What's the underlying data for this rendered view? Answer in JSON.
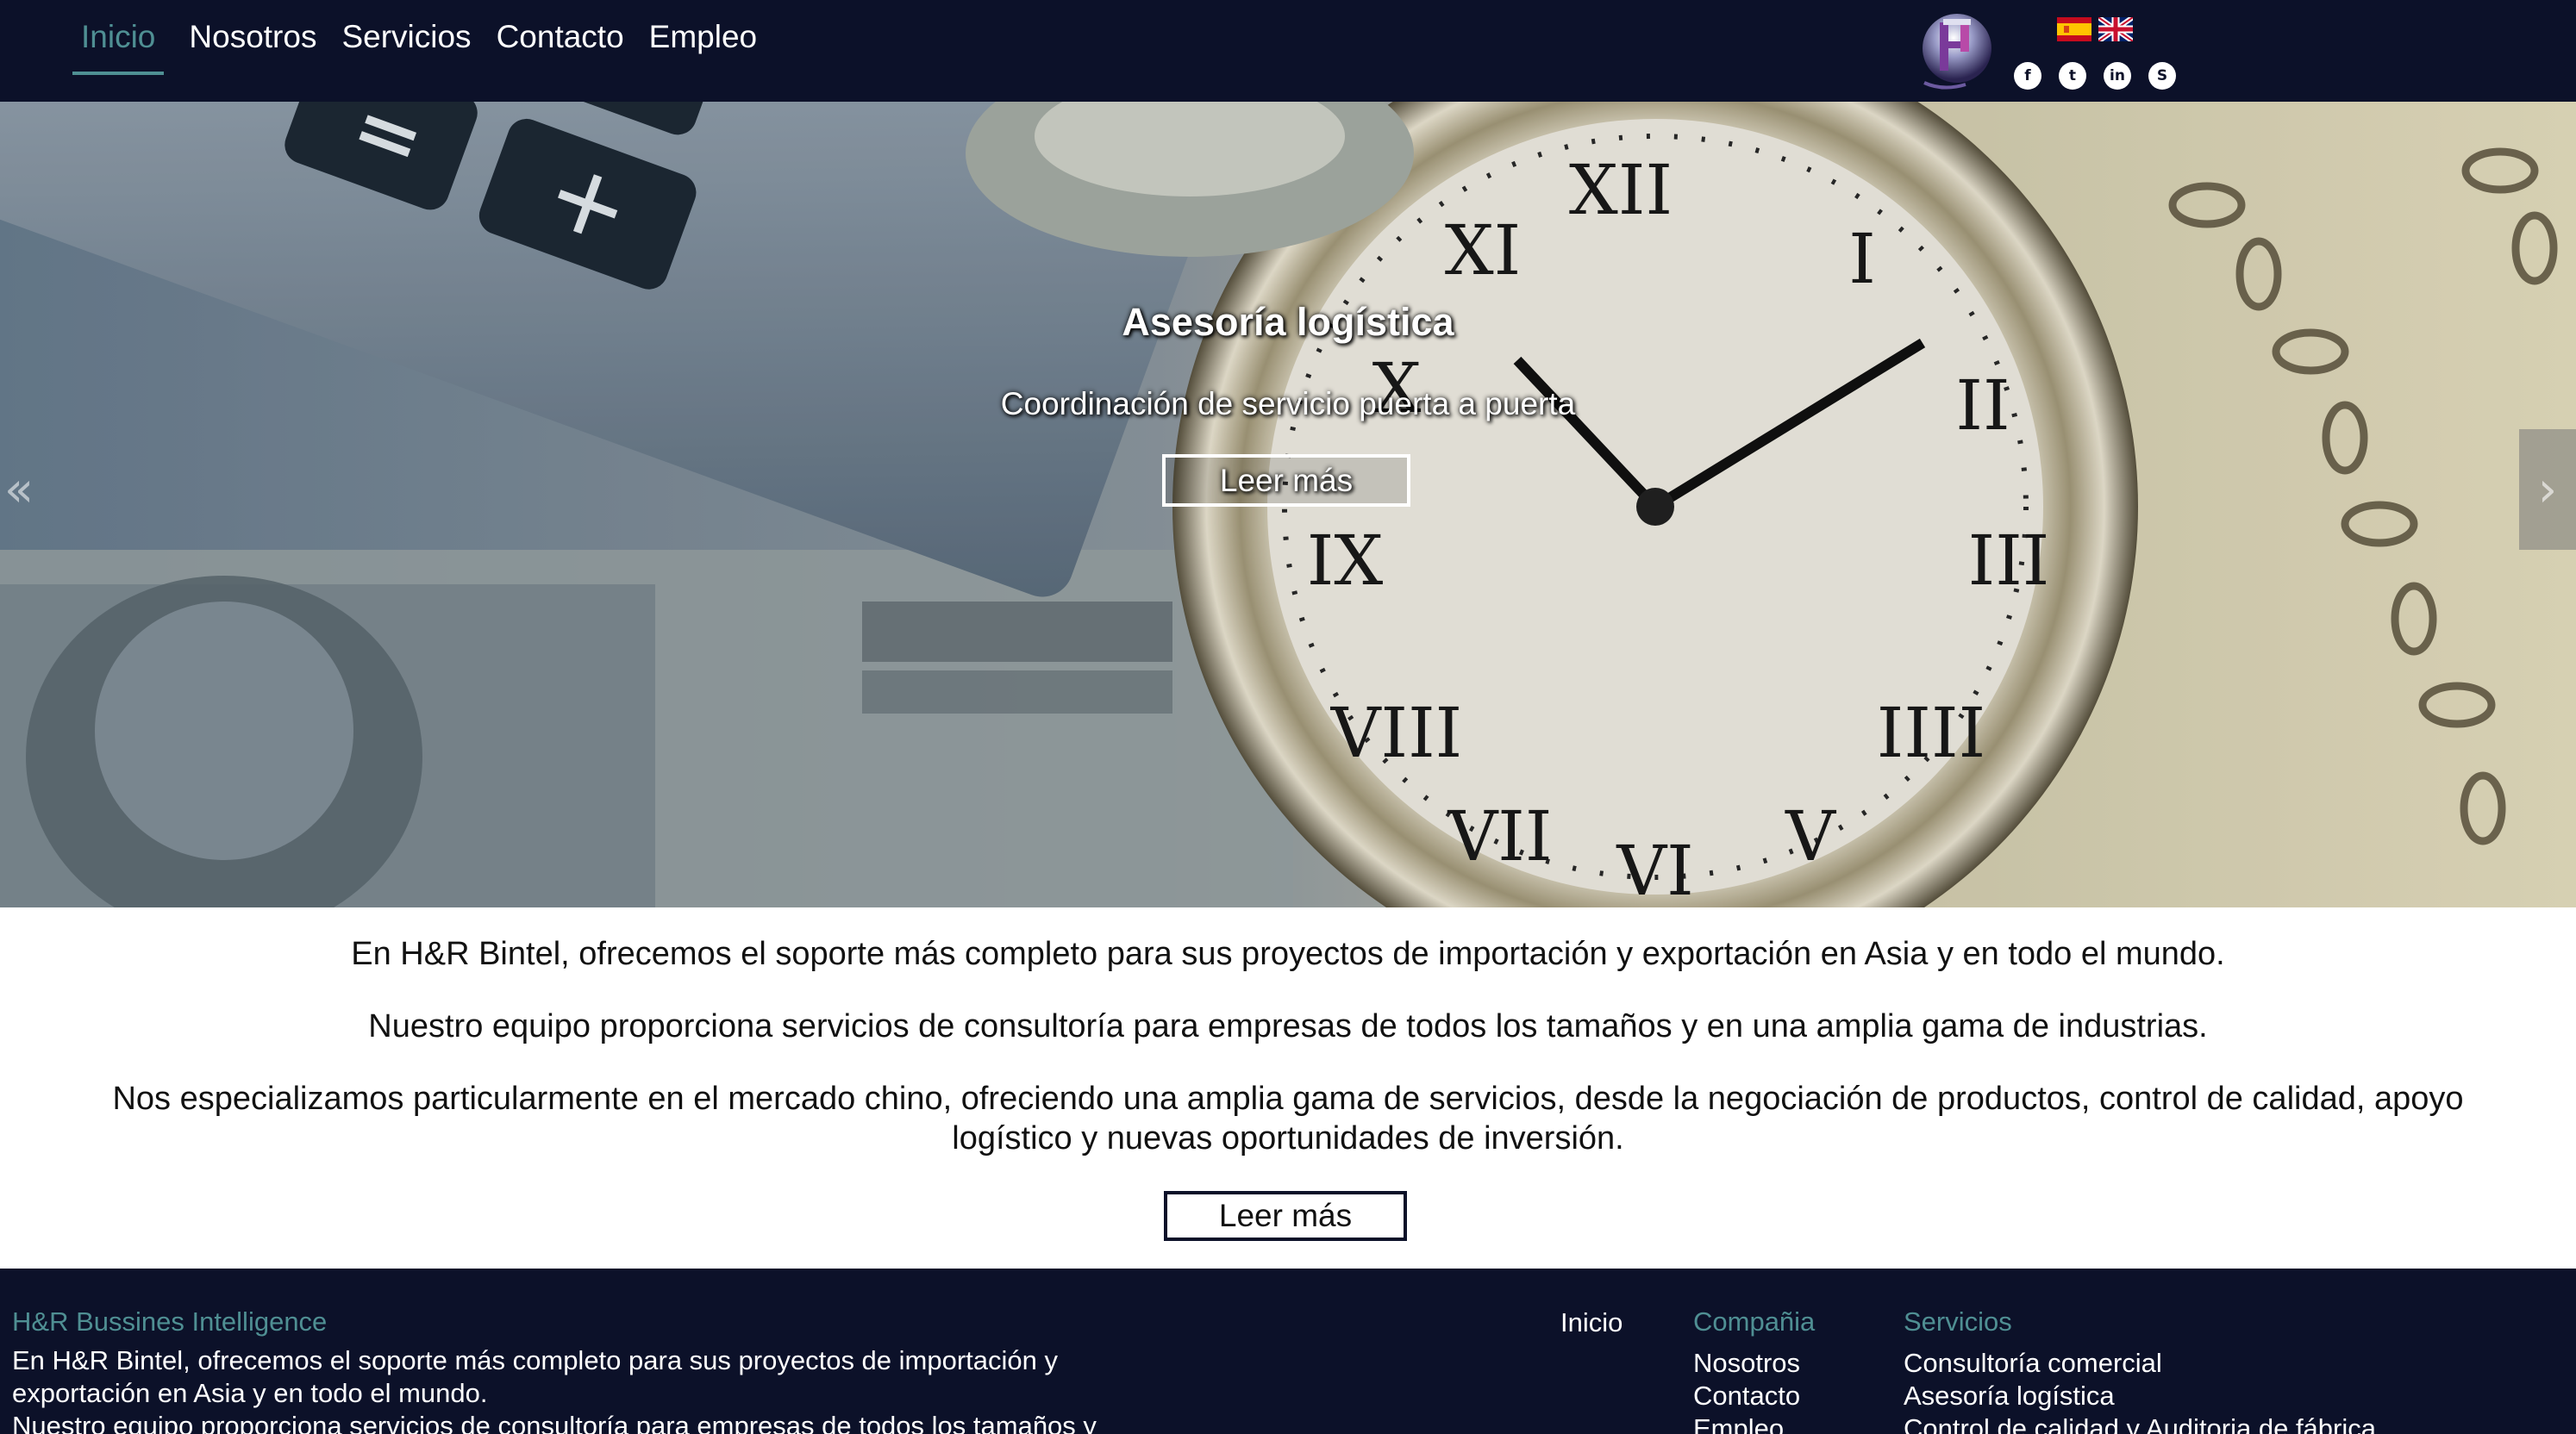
{
  "nav": {
    "items": [
      {
        "label": "Inicio",
        "active": true
      },
      {
        "label": "Nosotros"
      },
      {
        "label": "Servicios"
      },
      {
        "label": "Contacto"
      },
      {
        "label": "Empleo"
      }
    ]
  },
  "header": {
    "logo": "hr-bintel-logo-icon",
    "languages": [
      {
        "name": "spanish-flag-icon"
      },
      {
        "name": "uk-flag-icon"
      }
    ],
    "social": [
      {
        "name": "facebook-icon",
        "glyph": "f"
      },
      {
        "name": "twitter-icon",
        "glyph": "t"
      },
      {
        "name": "linkedin-icon",
        "glyph": "in"
      },
      {
        "name": "skype-icon",
        "glyph": "S"
      }
    ]
  },
  "hero": {
    "title": "Asesoría logística",
    "subtitle": "Coordinación de servicio puerta a puerta",
    "button_label": "Leer más",
    "prev_glyph": "«",
    "next_glyph": "›"
  },
  "intro": {
    "paragraphs": [
      "En H&R Bintel, ofrecemos el soporte más completo para sus proyectos de importación y exportación en Asia y en todo el mundo.",
      "Nuestro equipo proporciona servicios de consultoría para empresas de todos los tamaños y en una amplia gama de industrias.",
      "Nos especializamos particularmente en el mercado chino, ofreciendo una amplia gama de servicios, desde la negociación de productos, control de calidad, apoyo logístico y nuevas oportunidades de inversión."
    ],
    "button_label": "Leer más"
  },
  "footer": {
    "about_title": "H&R Bussines Intelligence",
    "about_lines": [
      "En H&R Bintel, ofrecemos el soporte más completo para sus proyectos de importación y exportación en Asia y en todo el mundo.",
      "Nuestro equipo proporciona servicios de consultoría para empresas de todos los tamaños y"
    ],
    "col_inicio_title": "Inicio",
    "col_compania_title": "Compañia",
    "col_compania_links": [
      "Nosotros",
      "Contacto",
      "Empleo"
    ],
    "col_servicios_title": "Servicios",
    "col_servicios_links": [
      "Consultoría comercial",
      "Asesoría logística",
      "Control de calidad y Auditoria de fábrica"
    ]
  },
  "colors": {
    "navy": "#0c1129",
    "teal_accent": "#4f8f93",
    "white": "#ffffff"
  }
}
